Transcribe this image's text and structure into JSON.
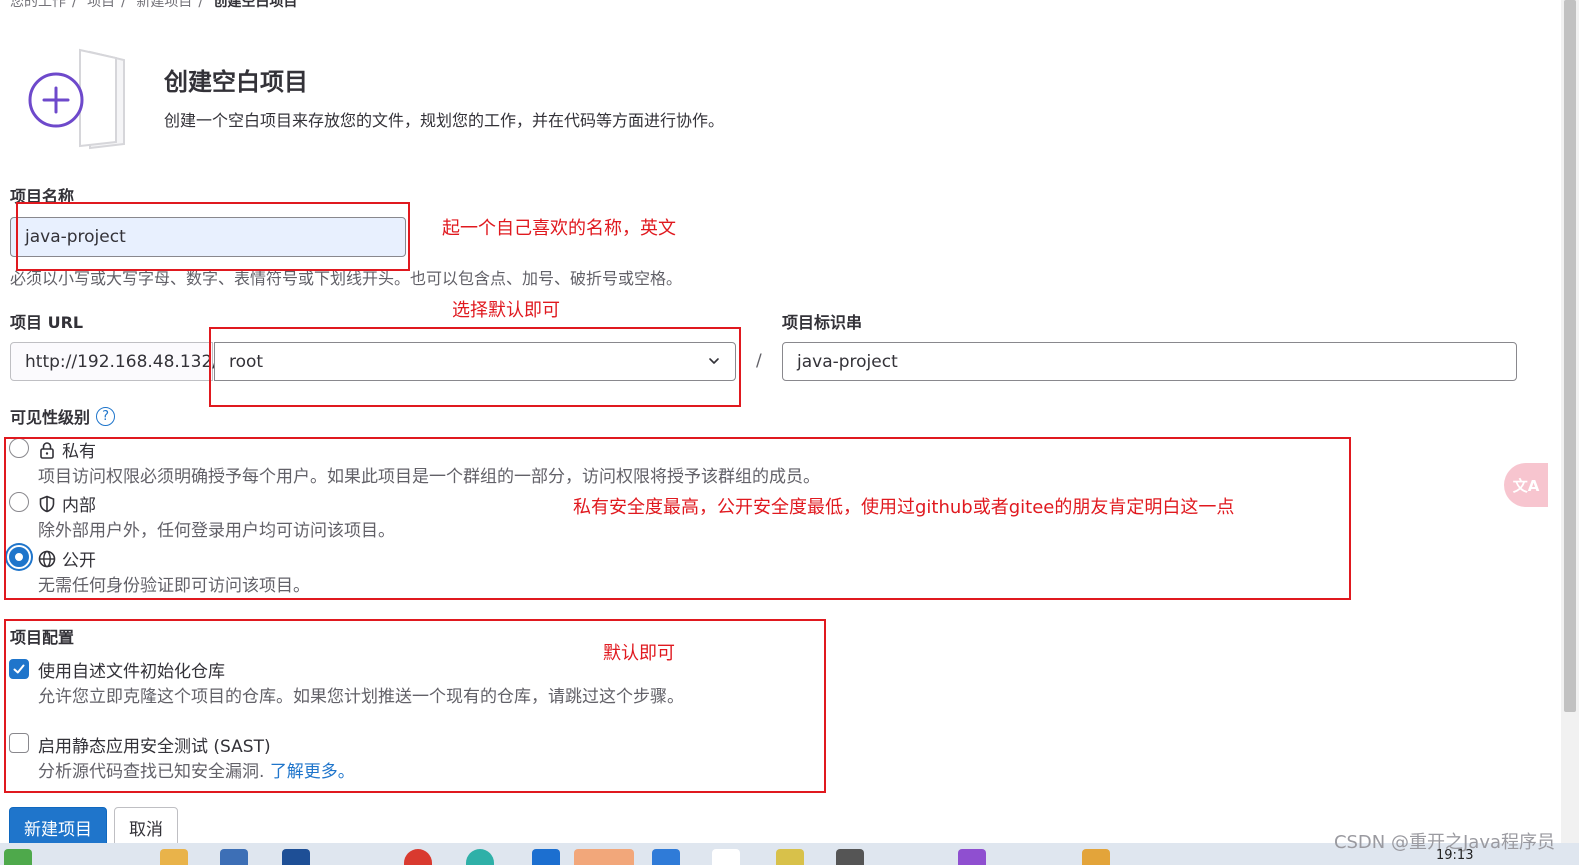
{
  "breadcrumb": [
    "您的工作",
    "项目",
    "新建项目",
    "创建空白项目"
  ],
  "header": {
    "title": "创建空白项目",
    "subtitle": "创建一个空白项目来存放您的文件，规划您的工作，并在代码等方面进行协作。"
  },
  "project_name": {
    "label": "项目名称",
    "value": "java-project",
    "hint": "必须以小写或大写字母、数字、表情符号或下划线开头。也可以包含点、加号、破折号或空格。"
  },
  "project_url": {
    "label": "项目 URL",
    "prefix": "http://192.168.48.132/",
    "namespace": "root",
    "separator": "/"
  },
  "project_slug": {
    "label": "项目标识串",
    "value": "java-project"
  },
  "visibility": {
    "label": "可见性级别",
    "help_icon": "?",
    "options": [
      {
        "label": "私有",
        "icon": "lock-icon",
        "description": "项目访问权限必须明确授予每个用户。如果此项目是一个群组的一部分，访问权限将授予该群组的成员。",
        "selected": false
      },
      {
        "label": "内部",
        "icon": "shield-icon",
        "description": "除外部用户外，任何登录用户均可访问该项目。",
        "selected": false
      },
      {
        "label": "公开",
        "icon": "globe-icon",
        "description": "无需任何身份验证即可访问该项目。",
        "selected": true
      }
    ]
  },
  "config": {
    "label": "项目配置",
    "options": [
      {
        "label": "使用自述文件初始化仓库",
        "description": "允许您立即克隆这个项目的仓库。如果您计划推送一个现有的仓库，请跳过这个步骤。",
        "checked": true
      },
      {
        "label": "启用静态应用安全测试 (SAST)",
        "description": "分析源代码查找已知安全漏洞.",
        "link": "了解更多。",
        "checked": false
      }
    ]
  },
  "buttons": {
    "create": "新建项目",
    "cancel": "取消"
  },
  "annotations": {
    "name": "起一个自己喜欢的名称，英文",
    "url": "选择默认即可",
    "visibility": "私有安全度最高，公开安全度最低，使用过github或者gitee的朋友肯定明白这一点",
    "config": "默认即可"
  },
  "overlay": {
    "translate_glyph": "文A",
    "watermark": "CSDN @重开之Java程序员",
    "clock": "19:13"
  },
  "colors": {
    "primary": "#1f75cb",
    "annotation": "#e0191f",
    "illustration": "#6e49cb"
  }
}
